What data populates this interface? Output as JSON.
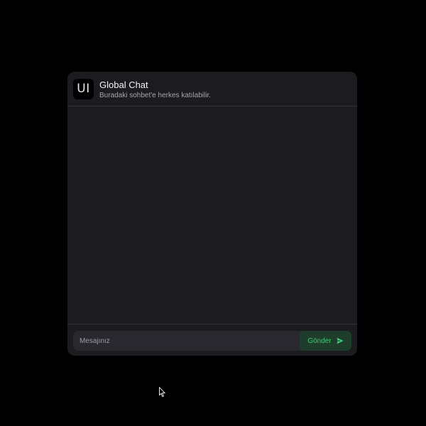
{
  "header": {
    "avatar_text": "UI",
    "title": "Global Chat",
    "subtitle": "Buradaki sohbet'e herkes katılabilir."
  },
  "messages": [],
  "composer": {
    "placeholder": "Mesajınız",
    "value": "",
    "send_label": "Gönder",
    "send_icon": "send-arrow-icon"
  },
  "colors": {
    "page_background": "#000000",
    "panel_background": "#1c1b1f",
    "divider": "#34333a",
    "input_background": "#29282e",
    "send_button_background": "#1f3d2c",
    "send_button_text": "#3ecb72"
  }
}
